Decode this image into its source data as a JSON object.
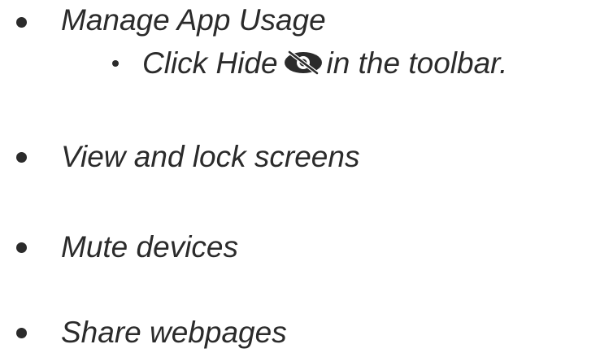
{
  "items": [
    {
      "label": "Manage App Usage",
      "subitem": {
        "prefix": "Click Hide",
        "icon": "hide-eye-icon",
        "suffix": "in the toolbar."
      }
    },
    {
      "label": "View and lock screens"
    },
    {
      "label": "Mute devices"
    },
    {
      "label": "Share webpages"
    }
  ],
  "colors": {
    "text": "#2b2b2b",
    "background": "#ffffff"
  }
}
